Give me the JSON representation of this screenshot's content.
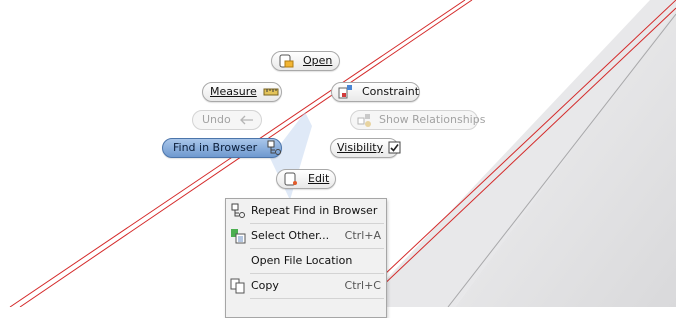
{
  "marking_menu": {
    "open": {
      "label": "Open",
      "icon": "open-file-icon"
    },
    "measure": {
      "label": "Measure",
      "icon": "ruler-icon"
    },
    "constraint": {
      "label": "Constraint",
      "icon": "constraint-icon"
    },
    "undo": {
      "label": "Undo",
      "icon": "undo-arrow-icon",
      "enabled": false
    },
    "show_relationships": {
      "label": "Show Relationships",
      "icon": "relationships-icon",
      "enabled": false
    },
    "find_in_browser": {
      "label": "Find in Browser",
      "icon": "browser-find-icon",
      "selected": true
    },
    "visibility": {
      "label": "Visibility",
      "icon": "checkbox-icon",
      "checked": true
    },
    "edit": {
      "label": "Edit",
      "icon": "edit-icon"
    }
  },
  "context_menu": {
    "items": [
      {
        "label": "Repeat Find in Browser",
        "shortcut": "",
        "icon": "browser-find-icon"
      },
      {
        "label": "Select Other...",
        "shortcut": "Ctrl+A",
        "icon": "select-other-icon"
      },
      {
        "label": "Open File Location",
        "shortcut": "",
        "icon": ""
      },
      {
        "label": "Copy",
        "shortcut": "Ctrl+C",
        "icon": "copy-icon"
      }
    ]
  },
  "colors": {
    "model_edge": "#d42a2a",
    "selection_blue": "#6f99cf",
    "menu_background": "#f1f1f1"
  }
}
